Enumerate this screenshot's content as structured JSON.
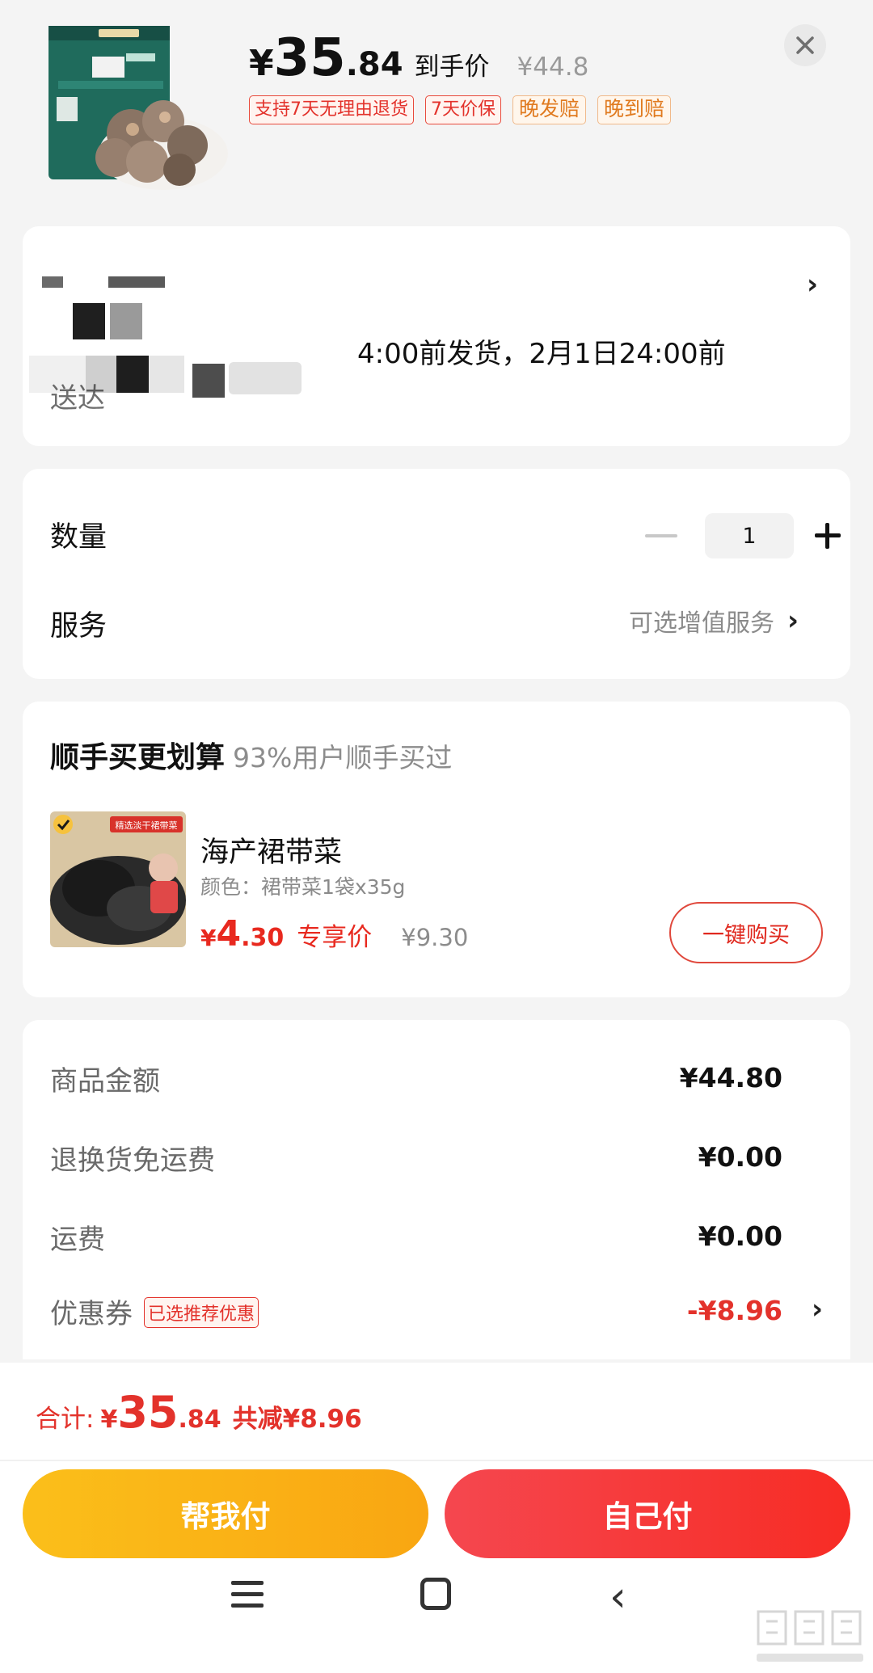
{
  "header": {
    "price_yen": "¥",
    "price_int": "35",
    "price_dec": ".84",
    "price_tag": "到手价",
    "original_price": "¥44.8",
    "badges": [
      "支持7天无理由退货",
      "7天价保",
      "晚发赔",
      "晚到赔"
    ]
  },
  "address": {
    "delivery_text": "4:00前发货，2月1日24:00前",
    "delivery_text_2": "送达"
  },
  "quantity": {
    "label": "数量",
    "value": "1"
  },
  "service": {
    "label": "服务",
    "value": "可选增值服务"
  },
  "upsell": {
    "title": "顺手买更划算",
    "subtitle": "93%用户顺手买过",
    "product_name": "海产裙带菜",
    "spec": "颜色：裙带菜1袋x35g",
    "price_yen": "¥",
    "price_int": "4",
    "price_dec": ".30",
    "exclusive_label": "专享价",
    "original_price": "¥9.30",
    "buy_button": "一键购买",
    "image_banner": "精选淡干裙带菜"
  },
  "summary": {
    "rows": [
      {
        "label": "商品金额",
        "value": "¥44.80"
      },
      {
        "label": "退换货免运费",
        "value": "¥0.00"
      },
      {
        "label": "运费",
        "value": "¥0.00"
      },
      {
        "label": "优惠券",
        "tag": "已选推荐优惠",
        "value": "-¥8.96"
      }
    ]
  },
  "bottom": {
    "total_label": "合计:",
    "total_yen": "¥",
    "total_int": "35",
    "total_dec": ".84",
    "saved": "共减¥8.96",
    "help_pay": "帮我付",
    "self_pay": "自己付"
  },
  "colors": {
    "accent_red": "#e3322b",
    "pay_yellow": "#fbbf1a",
    "pay_red": "#f5474f"
  },
  "icons": [
    "close-icon",
    "chevron-right-icon",
    "minus-icon",
    "plus-icon",
    "menu-icon",
    "home-icon",
    "back-icon"
  ]
}
